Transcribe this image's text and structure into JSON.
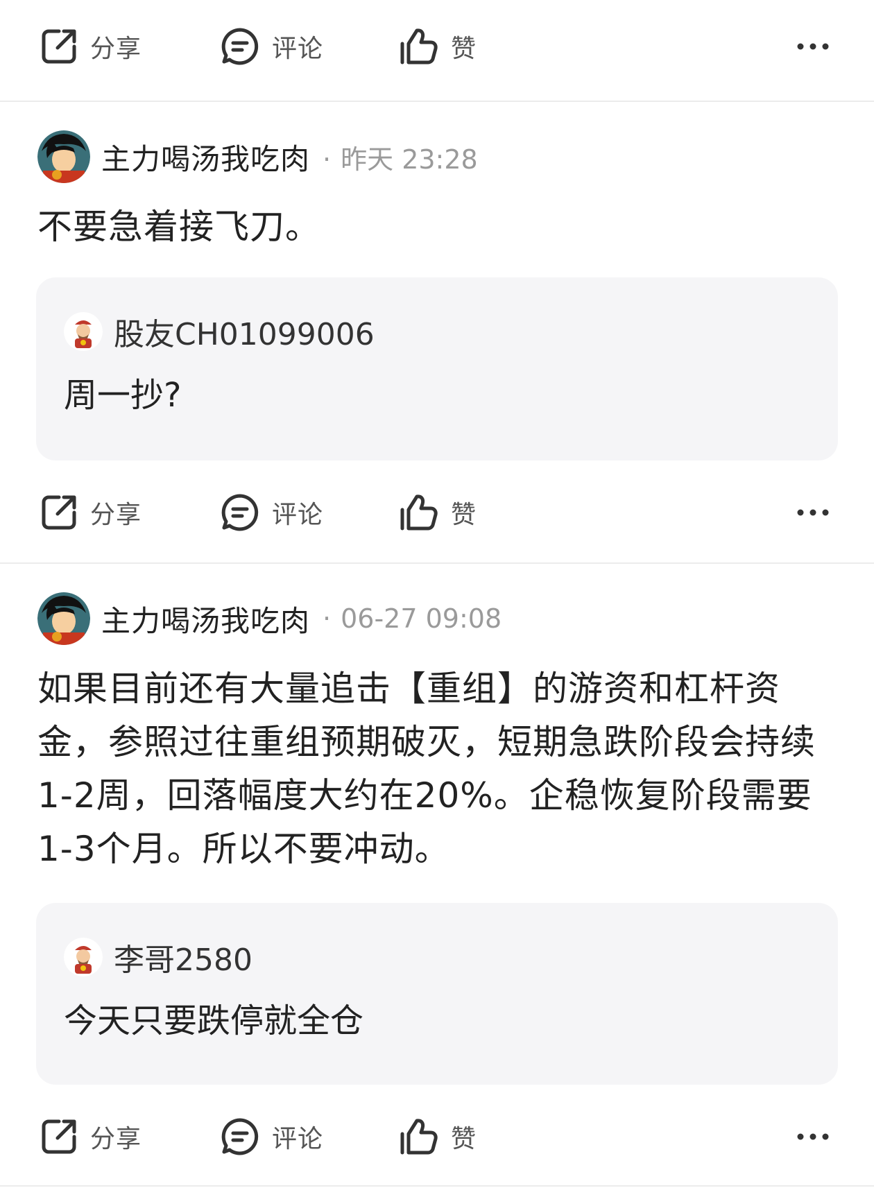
{
  "actions": {
    "share_label": "分享",
    "comment_label": "评论",
    "like_label": "赞"
  },
  "icons": {
    "share": "share-icon",
    "comment": "comment-icon",
    "like": "thumbs-up-icon",
    "more": "more-dots-icon"
  },
  "posts": [
    {
      "author": "主力喝汤我吃肉",
      "separator": "·",
      "time": "昨天 23:28",
      "body": "不要急着接飞刀。",
      "quote": {
        "user": "股友CH01099006",
        "text": "周一抄?"
      }
    },
    {
      "author": "主力喝汤我吃肉",
      "separator": "·",
      "time": "06-27 09:08",
      "body": "如果目前还有大量追击【重组】的游资和杠杆资金，参照过往重组预期破灭，短期急跌阶段会持续1-2周，回落幅度大约在20%。企稳恢复阶段需要1-3个月。所以不要冲动。",
      "quote": {
        "user": "李哥2580",
        "text": "今天只要跌停就全仓"
      }
    }
  ],
  "colors": {
    "background": "#ffffff",
    "quote_background": "#f5f5f7",
    "divider": "#ececec",
    "text_primary": "#222222",
    "text_meta": "#9a9a9a",
    "icon": "#333333"
  }
}
